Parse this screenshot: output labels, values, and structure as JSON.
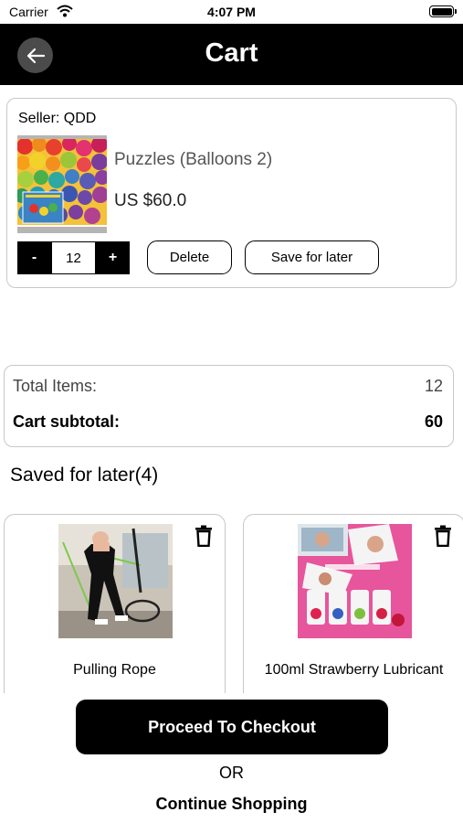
{
  "status_bar": {
    "carrier": "Carrier",
    "time": "4:07 PM"
  },
  "header": {
    "title": "Cart",
    "back_icon": "arrow-left-icon"
  },
  "cart_item": {
    "seller": "Seller: QDD",
    "name": "Puzzles (Balloons 2)",
    "price": "US $60.0",
    "quantity": "12",
    "minus_label": "-",
    "plus_label": "+",
    "delete_label": "Delete",
    "save_label": "Save for later"
  },
  "totals": {
    "items_label": "Total Items:",
    "items_value": "12",
    "subtotal_label": "Cart subtotal:",
    "subtotal_value": "60"
  },
  "saved": {
    "title": "Saved for later(4)",
    "items": [
      {
        "name": "Pulling Rope",
        "icon": "trash-icon"
      },
      {
        "name": "100ml Strawberry Lubricant",
        "icon": "trash-icon"
      }
    ]
  },
  "footer": {
    "checkout_label": "Proceed To Checkout",
    "or_label": "OR",
    "continue_label": "Continue Shopping"
  },
  "colors": {
    "header_bg": "#000000",
    "back_button_bg": "#4b4b4b",
    "card_border": "#c8c8c8",
    "accent_pink": "#e7559c"
  }
}
